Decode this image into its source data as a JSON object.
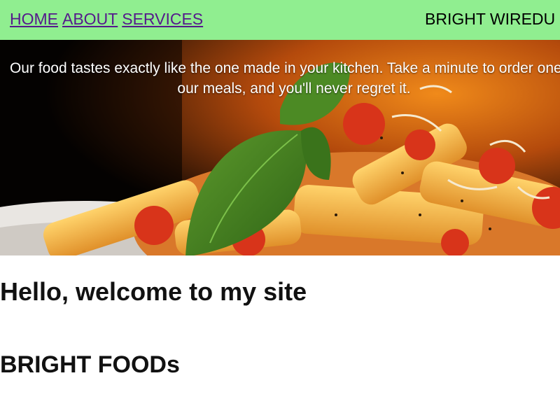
{
  "nav": {
    "links": [
      {
        "label": "HOME"
      },
      {
        "label": "ABOUT"
      },
      {
        "label": "SERVICES"
      }
    ],
    "brand": "BRIGHT WIREDU"
  },
  "hero": {
    "text": "Our food tastes exactly like the one made in your kitchen. Take a minute to order one of our meals, and you'll never regret it.",
    "image_subject": "penne-pasta-with-basil-photo"
  },
  "main": {
    "welcome_heading": "Hello, welcome to my site",
    "brand_heading": "BRIGHT FOODs"
  },
  "colors": {
    "navbar_bg": "#90ee90",
    "link": "#551a8b",
    "hero_text": "#ffffff"
  }
}
